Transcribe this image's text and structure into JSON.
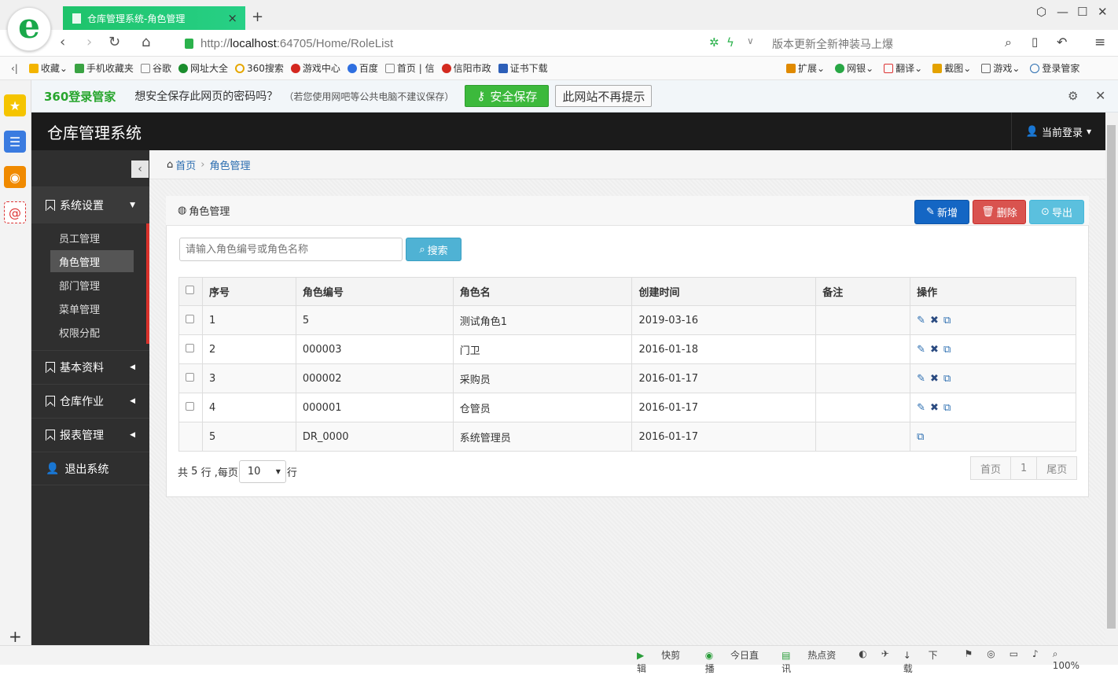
{
  "browser": {
    "tab_title": "仓库管理系统-角色管理",
    "url_prefix": "http://",
    "url_host": "localhost",
    "url_rest": ":64705/Home/RoleList",
    "news_text": "版本更新全新神装马上爆",
    "bookmarks": [
      "收藏",
      "手机收藏夹",
      "谷歌",
      "网址大全",
      "360搜索",
      "游戏中心",
      "百度",
      "首页 | 信",
      "信阳市政",
      "证书下载"
    ],
    "bookmarks_right": [
      "扩展",
      "网银",
      "翻译",
      "截图",
      "游戏",
      "登录管家"
    ],
    "status_items": [
      "快剪辑",
      "今日直播",
      "热点资讯",
      "下载",
      "100%"
    ]
  },
  "pwbar": {
    "brand": "360登录管家",
    "question": "想安全保存此网页的密码吗？",
    "hint": "（若您使用网吧等公共电脑不建议保存）",
    "save_label": "安全保存",
    "never_label": "此网站不再提示"
  },
  "app": {
    "title": "仓库管理系统",
    "current_user": "当前登录"
  },
  "sidebar": {
    "groups": [
      {
        "label": "系统设置"
      },
      {
        "label": "基本资料"
      },
      {
        "label": "仓库作业"
      },
      {
        "label": "报表管理"
      },
      {
        "label": "退出系统"
      }
    ],
    "subitems": [
      "员工管理",
      "角色管理",
      "部门管理",
      "菜单管理",
      "权限分配"
    ]
  },
  "breadcrumb": {
    "home": "首页",
    "current": "角色管理"
  },
  "panel": {
    "title": "角色管理",
    "add_label": "新增",
    "delete_label": "删除",
    "export_label": "导出"
  },
  "search": {
    "placeholder": "请输入角色编号或角色名称",
    "button_label": "搜索"
  },
  "table": {
    "headers": [
      "序号",
      "角色编号",
      "角色名",
      "创建时间",
      "备注",
      "操作"
    ],
    "rows": [
      {
        "no": "1",
        "code": "5",
        "name": "测试角色1",
        "created": "2019-03-16",
        "note": ""
      },
      {
        "no": "2",
        "code": "000003",
        "name": "门卫",
        "created": "2016-01-18",
        "note": ""
      },
      {
        "no": "3",
        "code": "000002",
        "name": "采购员",
        "created": "2016-01-17",
        "note": ""
      },
      {
        "no": "4",
        "code": "000001",
        "name": "仓管员",
        "created": "2016-01-17",
        "note": ""
      },
      {
        "no": "5",
        "code": "DR_0000",
        "name": "系统管理员",
        "created": "2016-01-17",
        "note": ""
      }
    ]
  },
  "footer": {
    "total_prefix": "共",
    "total_count": "5",
    "total_suffix": "行 ,每页",
    "page_size": "10",
    "page_suffix": "行"
  },
  "pager": {
    "first": "首页",
    "current": "1",
    "last": "尾页"
  }
}
